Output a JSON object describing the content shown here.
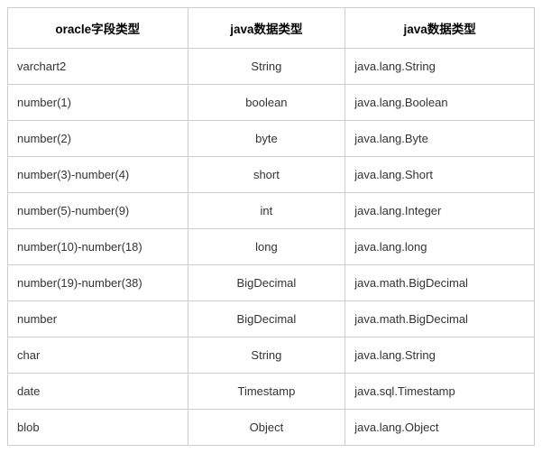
{
  "table": {
    "headers": [
      "oracle字段类型",
      "java数据类型",
      "java数据类型"
    ],
    "rows": [
      [
        "varchart2",
        "String",
        "java.lang.String"
      ],
      [
        "number(1)",
        "boolean",
        "java.lang.Boolean"
      ],
      [
        "number(2)",
        "byte",
        "java.lang.Byte"
      ],
      [
        "number(3)-number(4)",
        "short",
        "java.lang.Short"
      ],
      [
        "number(5)-number(9)",
        "int",
        "java.lang.Integer"
      ],
      [
        "number(10)-number(18)",
        "long",
        "java.lang.long"
      ],
      [
        "number(19)-number(38)",
        "BigDecimal",
        "java.math.BigDecimal"
      ],
      [
        "number",
        "BigDecimal",
        "java.math.BigDecimal"
      ],
      [
        "char",
        "String",
        "java.lang.String"
      ],
      [
        "date",
        "Timestamp",
        "java.sql.Timestamp"
      ],
      [
        "blob",
        "Object",
        "java.lang.Object"
      ]
    ]
  }
}
